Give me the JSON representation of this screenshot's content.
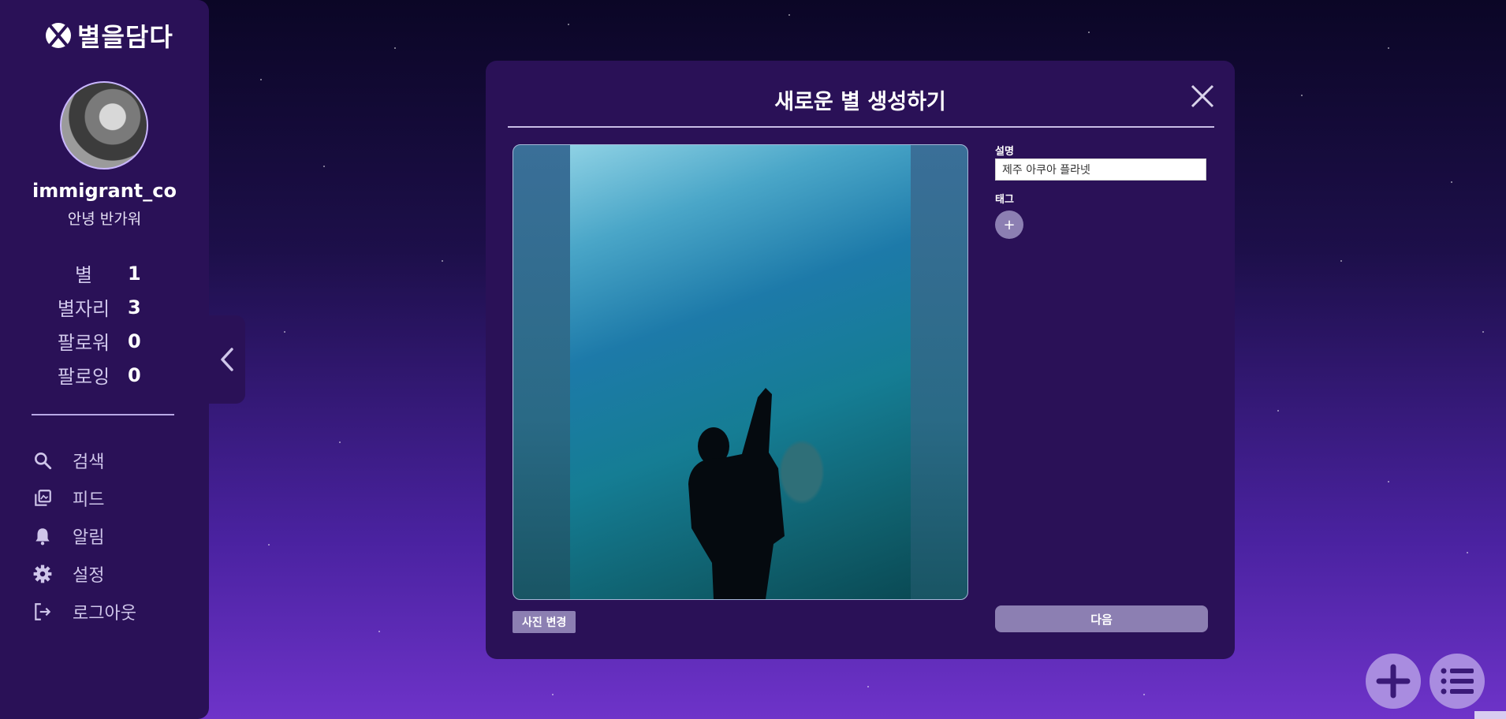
{
  "app": {
    "logo_text": "별을담다"
  },
  "profile": {
    "username": "immigrant_co",
    "bio": "안녕 반가워",
    "stats": [
      {
        "label": "별",
        "value": "1"
      },
      {
        "label": "별자리",
        "value": "3"
      },
      {
        "label": "팔로워",
        "value": "0"
      },
      {
        "label": "팔로잉",
        "value": "0"
      }
    ]
  },
  "nav": {
    "items": [
      {
        "label": "검색",
        "icon": "search-icon"
      },
      {
        "label": "피드",
        "icon": "feed-icon"
      },
      {
        "label": "알림",
        "icon": "bell-icon"
      },
      {
        "label": "설정",
        "icon": "gear-icon"
      },
      {
        "label": "로그아웃",
        "icon": "logout-icon"
      }
    ]
  },
  "modal": {
    "title": "새로운 별 생성하기",
    "change_photo_label": "사진 변경",
    "description_label": "설명",
    "description_value": "제주 아쿠아 플라넷",
    "tag_label": "태그",
    "tag_add_label": "+",
    "next_label": "다음"
  },
  "colors": {
    "sidebar_bg": "#2a1157",
    "accent": "#8c7fb2",
    "fab": "#a98ce0"
  }
}
